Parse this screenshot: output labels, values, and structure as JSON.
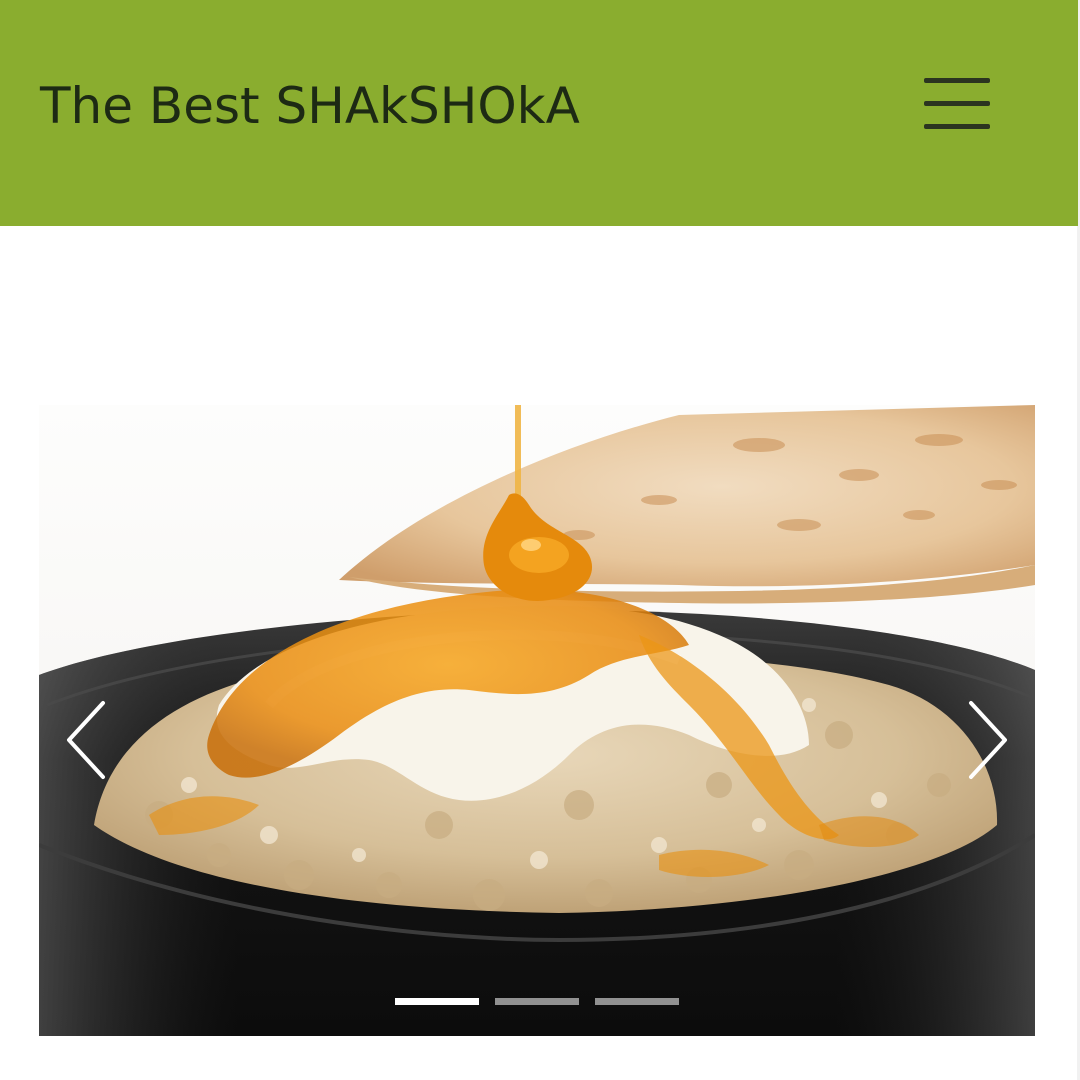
{
  "header": {
    "brand": "The Best SHAkSHOkA",
    "menu_icon": "hamburger-menu-icon",
    "background_color": "#8aad2f"
  },
  "carousel": {
    "slide_description": "bowl of oatmeal with yogurt and honey, flatbread behind",
    "prev_icon": "chevron-left-icon",
    "next_icon": "chevron-right-icon",
    "indicators": [
      {
        "active": true
      },
      {
        "active": false
      },
      {
        "active": false
      }
    ],
    "active_index": 0,
    "slide_count": 3
  }
}
